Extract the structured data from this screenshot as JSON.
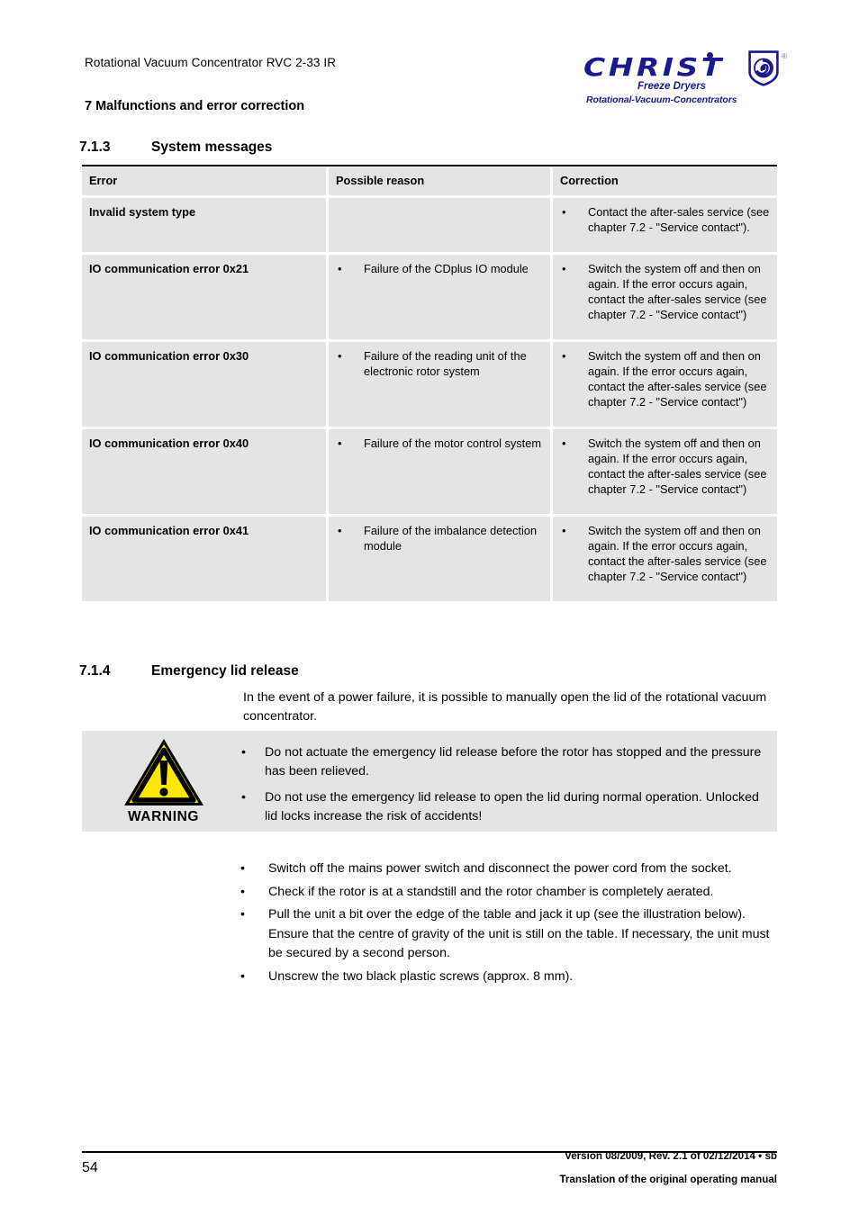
{
  "header": {
    "document_title": "Rotational Vacuum Concentrator RVC 2-33 IR",
    "chapter": "7 Malfunctions and error correction"
  },
  "logo": {
    "brand": "CHRIST",
    "tagline_1": "Freeze Dryers",
    "tagline_2": "Rotational-Vacuum-Concentrators",
    "registered_mark": "®",
    "brand_color": "#1a1a8c"
  },
  "sections": {
    "s713": {
      "number": "7.1.3",
      "title": "System messages"
    },
    "s714": {
      "number": "7.1.4",
      "title": "Emergency lid release"
    }
  },
  "table": {
    "columns": [
      "Error",
      "Possible reason",
      "Correction"
    ],
    "bullet_glyph": "•",
    "rows": [
      {
        "error": "Invalid system type",
        "reason": "",
        "correction": "Contact the after-sales service (see chapter 7.2 - \"Service contact\")."
      },
      {
        "error": "IO communication error 0x21",
        "reason": "Failure of the CDplus IO module",
        "correction": "Switch the system off and then on again. If the error occurs again, contact the after-sales service (see chapter 7.2 - \"Service contact\")"
      },
      {
        "error": "IO communication error 0x30",
        "reason": "Failure of the reading unit of the electronic rotor system",
        "correction": "Switch the system off and then on again. If the error occurs again, contact the after-sales service (see chapter 7.2 - \"Service contact\")"
      },
      {
        "error": "IO communication error 0x40",
        "reason": "Failure of the motor control system",
        "correction": "Switch the system off and then on again. If the error occurs again, contact the after-sales service (see chapter 7.2 - \"Service contact\")"
      },
      {
        "error": "IO communication error 0x41",
        "reason": "Failure of the imbalance detection module",
        "correction": "Switch the system off and then on again. If the error occurs again, contact the after-sales service (see chapter 7.2 - \"Service contact\")"
      }
    ]
  },
  "emergency": {
    "intro": "In the event of a power failure, it is possible to manually open the lid of the rotational vacuum concentrator.",
    "warning": {
      "label": "WARNING",
      "icon_colors": {
        "fill": "#ffe800",
        "stroke": "#000000"
      },
      "bullet_glyph": "•",
      "items": [
        "Do not actuate the emergency lid release before the rotor has stopped and the pressure has been relieved.",
        "Do not use the emergency lid release to open the lid during normal operation. Unlocked lid locks increase the risk of accidents!"
      ]
    },
    "bullet_glyph": "•",
    "steps": [
      "Switch off the mains power switch and disconnect the power cord from the socket.",
      "Check if the rotor is at a standstill and the rotor chamber is completely aerated.",
      "Pull the unit a bit over the edge of the table and jack it up (see the illustration below). Ensure that the centre of gravity of the unit is still on the table. If necessary, the unit must be secured by a second person.",
      "Unscrew the two black plastic screws (approx. 8 mm)."
    ]
  },
  "footer": {
    "page_number": "54",
    "version_line": "Version 08/2009, Rev. 2.1 of 02/12/2014 • sb",
    "translation_line": "Translation of the original operating manual"
  }
}
